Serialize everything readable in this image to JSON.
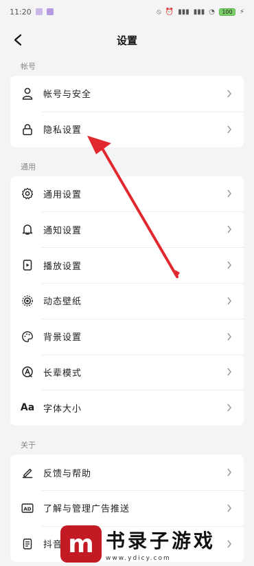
{
  "status_bar": {
    "time": "11:20",
    "battery": "100"
  },
  "header": {
    "title": "设置"
  },
  "sections": [
    {
      "label": "帐号",
      "items": [
        {
          "label": "帐号与安全",
          "icon": "person-icon"
        },
        {
          "label": "隐私设置",
          "icon": "lock-icon"
        }
      ]
    },
    {
      "label": "通用",
      "items": [
        {
          "label": "通用设置",
          "icon": "gear-icon"
        },
        {
          "label": "通知设置",
          "icon": "bell-icon"
        },
        {
          "label": "播放设置",
          "icon": "play-icon"
        },
        {
          "label": "动态壁纸",
          "icon": "wallpaper-icon"
        },
        {
          "label": "背景设置",
          "icon": "palette-icon"
        },
        {
          "label": "长辈模式",
          "icon": "elder-mode-icon"
        },
        {
          "label": "字体大小",
          "icon": "font-size-icon",
          "glyph": "Aa"
        }
      ]
    },
    {
      "label": "关于",
      "items": [
        {
          "label": "反馈与帮助",
          "icon": "edit-icon"
        },
        {
          "label": "了解与管理广告推送",
          "icon": "ad-icon"
        },
        {
          "label": "抖音规则",
          "icon": "document-icon"
        }
      ]
    }
  ],
  "watermark": {
    "logo": "m",
    "text": "书录子游戏",
    "url": "www.ydicy.com"
  },
  "colors": {
    "background": "#f4f4f6",
    "card": "#ffffff",
    "arrow": "#e0282e"
  }
}
